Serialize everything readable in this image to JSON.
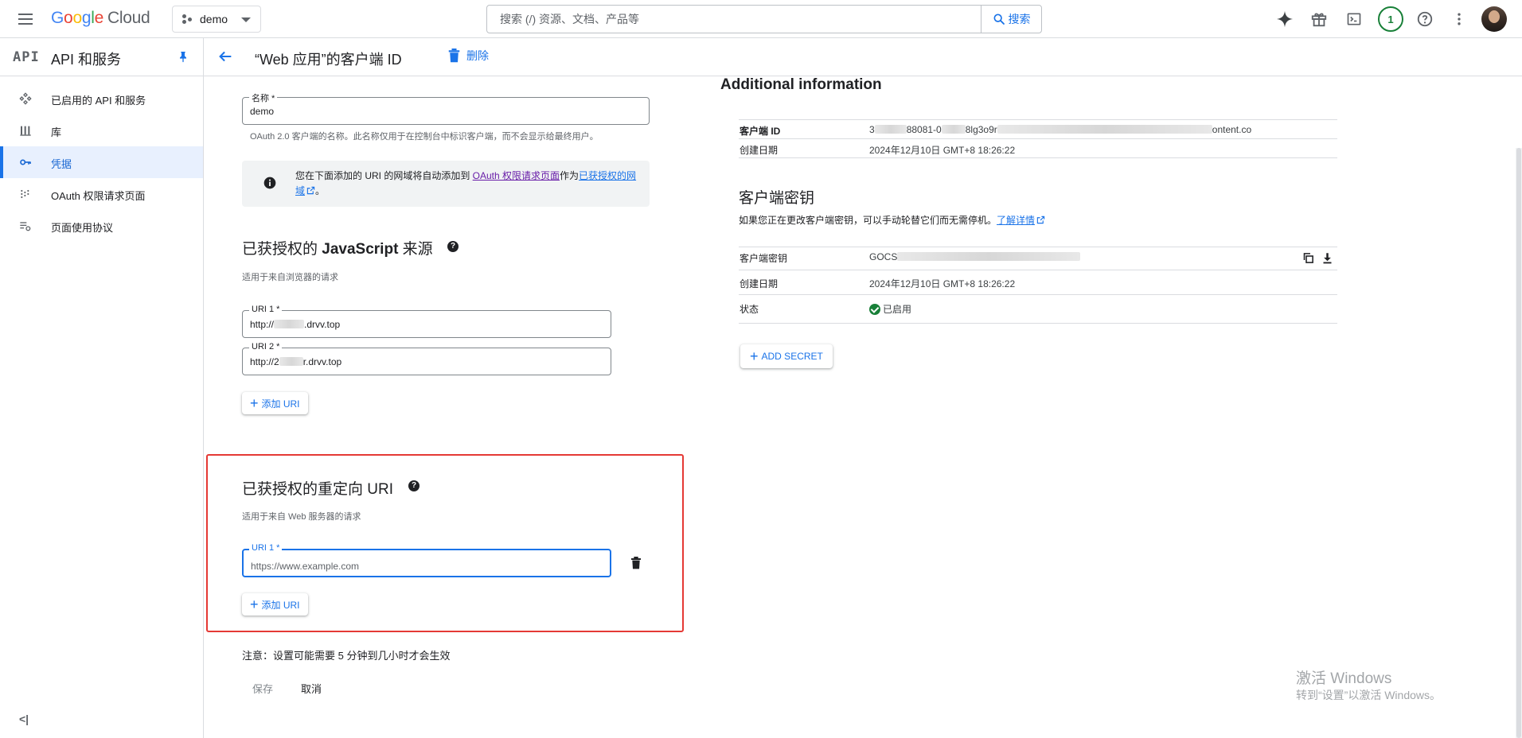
{
  "topbar": {
    "logo_google": [
      "G",
      "o",
      "o",
      "g",
      "l",
      "e"
    ],
    "logo_cloud": "Cloud",
    "project": "demo",
    "search_placeholder": "搜索 (/) 资源、文档、产品等",
    "search_button": "搜索",
    "notification_count": "1"
  },
  "sidebar": {
    "api_logo": "API",
    "title": "API 和服务",
    "items": [
      {
        "label": "已启用的 API 和服务",
        "icon": "api-services-icon"
      },
      {
        "label": "库",
        "icon": "library-icon"
      },
      {
        "label": "凭据",
        "icon": "key-icon",
        "active": true
      },
      {
        "label": "OAuth 权限请求页面",
        "icon": "consent-screen-icon"
      },
      {
        "label": "页面使用协议",
        "icon": "page-agreements-icon"
      }
    ],
    "collapse_glyph": "<|"
  },
  "page": {
    "title": "“Web 应用”的客户端 ID",
    "delete_label": "删除"
  },
  "form": {
    "name_label": "名称 *",
    "name_value": "demo",
    "name_hint": "OAuth 2.0 客户端的名称。此名称仅用于在控制台中标识客户端，而不会显示给最终用户。",
    "info": {
      "text_before": "您在下面添加的 URI 的网域将自动添加到 ",
      "link1": "OAuth 权限请求页面",
      "text_mid": "作为",
      "link2": "已获授权的网域",
      "text_after": "。"
    },
    "js_origins": {
      "title_prefix": "已获授权的 ",
      "title_bold": "JavaScript",
      "title_suffix": " 来源",
      "hint": "适用于来自浏览器的请求",
      "uris": [
        {
          "label": "URI 1 *",
          "prefix": "http://",
          "suffix": ".drvv.top"
        },
        {
          "label": "URI 2 *",
          "prefix": "http://2",
          "suffix": "r.drvv.top"
        }
      ],
      "add_label": "添加 URI"
    },
    "redirect_uris": {
      "title": "已获授权的重定向 URI",
      "hint": "适用于来自 Web 服务器的请求",
      "uri_label": "URI 1 *",
      "uri_placeholder": "https://www.example.com",
      "add_label": "添加 URI"
    },
    "note": "注意：设置可能需要 5 分钟到几小时才会生效",
    "save_label": "保存",
    "cancel_label": "取消"
  },
  "additional": {
    "title": "Additional information",
    "client_id_key": "客户端 ID",
    "client_id_prefix": "3",
    "client_id_mid1": "88081-0",
    "client_id_mid2": "8lg3o9r",
    "client_id_tail": "ontent.co",
    "created_key": "创建日期",
    "created_value": "2024年12月10日 GMT+8 18:26:22"
  },
  "secrets": {
    "title": "客户端密钥",
    "desc": "如果您正在更改客户端密钥，可以手动轮替它们而无需停机。",
    "learn_more": "了解详情",
    "secret_key": "客户端密钥",
    "secret_prefix": "GOCS",
    "created_key": "创建日期",
    "created_value": "2024年12月10日 GMT+8 18:26:22",
    "status_key": "状态",
    "status_value": "已启用",
    "add_secret": "ADD SECRET"
  },
  "watermark": {
    "line1": "激活 Windows",
    "line2": "转到“设置”以激活 Windows。"
  },
  "colors": {
    "accent": "#1a73e8",
    "active_bg": "#e8f0fe",
    "status_green": "#188038",
    "highlight_red": "#e53935"
  }
}
